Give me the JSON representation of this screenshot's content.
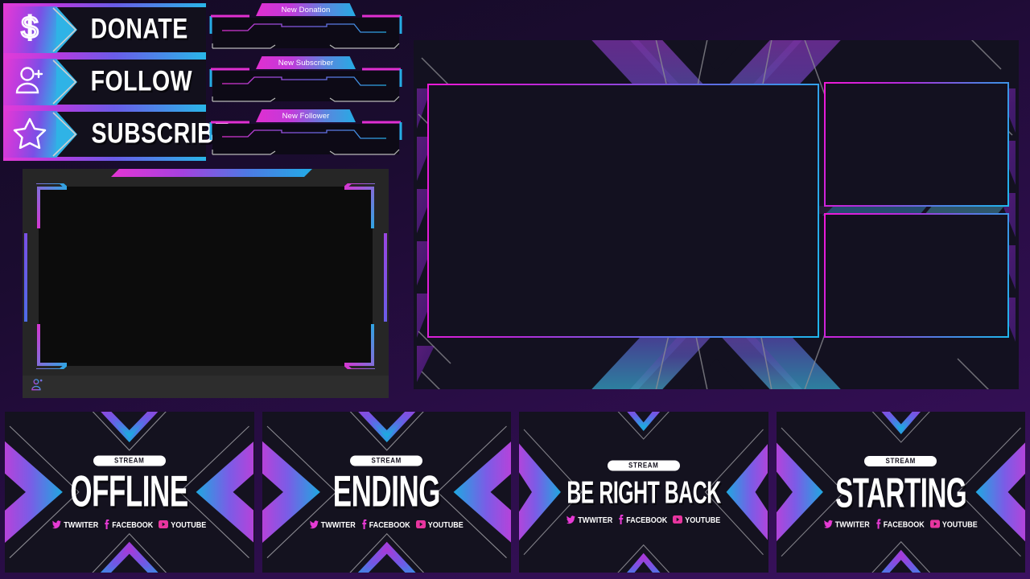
{
  "theme": {
    "accent_magenta": "#e63ad4",
    "accent_purple": "#7b4fe6",
    "accent_cyan": "#2fb3e6",
    "panel_bg": "#131120",
    "page_bg": "#1b0c30"
  },
  "action_buttons": [
    {
      "label": "DONATE",
      "icon": "dollar-sign-icon"
    },
    {
      "label": "FOLLOW",
      "icon": "user-plus-icon"
    },
    {
      "label": "SUBSCRIBE",
      "icon": "star-icon"
    }
  ],
  "alerts": [
    {
      "label": "New Donation"
    },
    {
      "label": "New Subscriber"
    },
    {
      "label": "New Follower"
    }
  ],
  "webcam": {
    "footer_icon": "user-plus-icon"
  },
  "main_panel": {
    "game_screen_label": "",
    "side_panels": [
      {
        "label": ""
      },
      {
        "label": ""
      }
    ]
  },
  "banners": [
    {
      "badge": "STREAM",
      "title": "OFFLINE",
      "title_size": "38px",
      "socials": [
        {
          "name": "TWWITER",
          "icon": "twitter-icon",
          "color": "#e63ad4"
        },
        {
          "name": "FACEBOOK",
          "icon": "facebook-icon",
          "color": "#e63ad4"
        },
        {
          "name": "YOUTUBE",
          "icon": "youtube-icon",
          "color": "#e8359f"
        }
      ]
    },
    {
      "badge": "STREAM",
      "title": "ENDING",
      "title_size": "38px",
      "socials": [
        {
          "name": "TWWITER",
          "icon": "twitter-icon",
          "color": "#e63ad4"
        },
        {
          "name": "FACEBOOK",
          "icon": "facebook-icon",
          "color": "#e63ad4"
        },
        {
          "name": "YOUTUBE",
          "icon": "youtube-icon",
          "color": "#e8359f"
        }
      ]
    },
    {
      "badge": "STREAM",
      "title": "BE RIGHT BACK",
      "title_size": "28px",
      "socials": [
        {
          "name": "TWWITER",
          "icon": "twitter-icon",
          "color": "#e63ad4"
        },
        {
          "name": "FACEBOOK",
          "icon": "facebook-icon",
          "color": "#e63ad4"
        },
        {
          "name": "YOUTUBE",
          "icon": "youtube-icon",
          "color": "#e8359f"
        }
      ]
    },
    {
      "badge": "STREAM",
      "title": "STARTING",
      "title_size": "36px",
      "socials": [
        {
          "name": "TWWITER",
          "icon": "twitter-icon",
          "color": "#e63ad4"
        },
        {
          "name": "FACEBOOK",
          "icon": "facebook-icon",
          "color": "#e63ad4"
        },
        {
          "name": "YOUTUBE",
          "icon": "youtube-icon",
          "color": "#e8359f"
        }
      ]
    }
  ]
}
